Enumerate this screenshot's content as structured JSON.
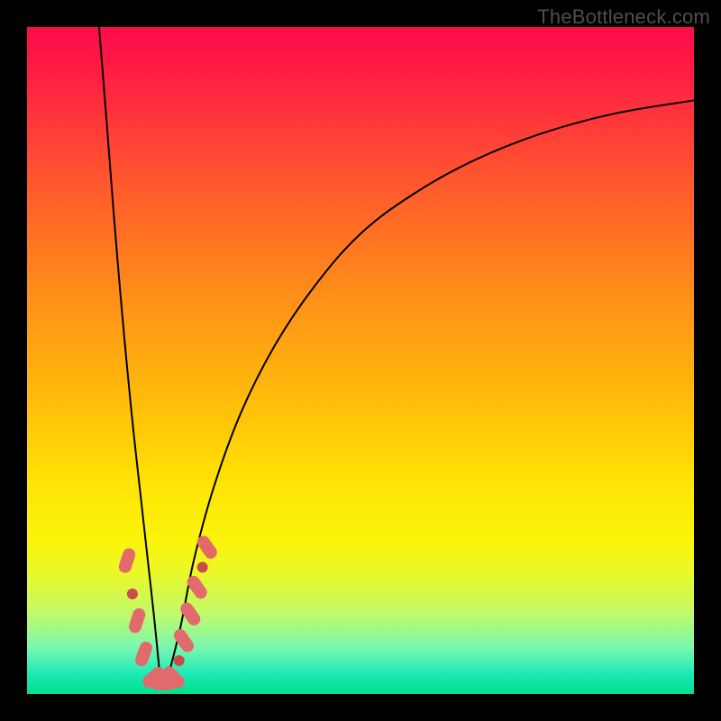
{
  "watermark": "TheBottleneck.com",
  "colors": {
    "frame": "#000000",
    "curve": "#000000",
    "marker_fill": "#e36a6c",
    "marker_dot": "#c84b4d",
    "gradient_top": "#ff0b4a",
    "gradient_bottom": "#00e08e"
  },
  "chart_data": {
    "type": "line",
    "title": "",
    "xlabel": "",
    "ylabel": "",
    "xlim": [
      0,
      100
    ],
    "ylim": [
      0,
      100
    ],
    "grid": false,
    "legend": false,
    "notes": "V-shaped bottleneck curve. x represents relative hardware balance parameter (0–100). y represents bottleneck percentage (0 = no bottleneck = green, 100 = severe bottleneck = red). Minimum near x≈20. Background is a vertical heatmap of y (red top → green bottom). Pink capsule/dot markers cluster near the bottom of the V on both arms.",
    "series": [
      {
        "name": "left_arm",
        "x": [
          10.8,
          12,
          13,
          14,
          15,
          16,
          17,
          18,
          19,
          20
        ],
        "y": [
          100,
          85,
          72,
          60,
          49,
          39,
          30,
          21,
          12,
          2
        ]
      },
      {
        "name": "right_arm",
        "x": [
          21,
          23,
          25,
          28,
          32,
          37,
          43,
          50,
          58,
          67,
          77,
          88,
          100
        ],
        "y": [
          2,
          10,
          20,
          31,
          42,
          52,
          61,
          69,
          75,
          80,
          84,
          87,
          89
        ]
      }
    ],
    "markers": [
      {
        "x": 15.0,
        "y": 20,
        "shape": "capsule",
        "angle": -72
      },
      {
        "x": 15.8,
        "y": 15,
        "shape": "dot"
      },
      {
        "x": 16.5,
        "y": 11,
        "shape": "capsule",
        "angle": -72
      },
      {
        "x": 17.5,
        "y": 6,
        "shape": "capsule",
        "angle": -70
      },
      {
        "x": 19.0,
        "y": 2.5,
        "shape": "capsule",
        "angle": -40
      },
      {
        "x": 20.5,
        "y": 1.5,
        "shape": "capsule",
        "angle": 0
      },
      {
        "x": 22.0,
        "y": 2.5,
        "shape": "capsule",
        "angle": 45
      },
      {
        "x": 22.8,
        "y": 5,
        "shape": "dot"
      },
      {
        "x": 23.5,
        "y": 8,
        "shape": "capsule",
        "angle": 55
      },
      {
        "x": 24.5,
        "y": 12,
        "shape": "capsule",
        "angle": 55
      },
      {
        "x": 25.5,
        "y": 16,
        "shape": "capsule",
        "angle": 55
      },
      {
        "x": 26.3,
        "y": 19,
        "shape": "dot"
      },
      {
        "x": 27.0,
        "y": 22,
        "shape": "capsule",
        "angle": 55
      }
    ]
  }
}
